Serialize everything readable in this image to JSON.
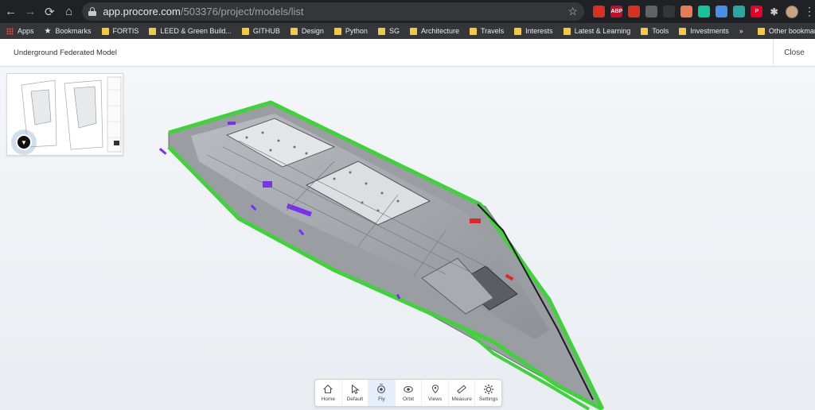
{
  "browser": {
    "url_host": "app.procore.com",
    "url_path": "/503376/project/models/list"
  },
  "bookmarks": [
    {
      "label": "Apps",
      "icon": "apps-grid-icon"
    },
    {
      "label": "Bookmarks",
      "icon": "star-icon"
    },
    {
      "label": "FORTIS",
      "icon": "folder-icon"
    },
    {
      "label": "LEED & Green Build...",
      "icon": "folder-icon"
    },
    {
      "label": "GITHUB",
      "icon": "folder-icon"
    },
    {
      "label": "Design",
      "icon": "folder-icon"
    },
    {
      "label": "Python",
      "icon": "folder-icon"
    },
    {
      "label": "SG",
      "icon": "folder-icon"
    },
    {
      "label": "Architecture",
      "icon": "folder-icon"
    },
    {
      "label": "Travels",
      "icon": "folder-icon"
    },
    {
      "label": "Interests",
      "icon": "folder-icon"
    },
    {
      "label": "Latest & Learning",
      "icon": "folder-icon"
    },
    {
      "label": "Tools",
      "icon": "folder-icon"
    },
    {
      "label": "Investments",
      "icon": "folder-icon"
    }
  ],
  "bookmarks_more": "»",
  "other_bookmarks": "Other bookmarks",
  "extensions": [
    {
      "name": "shield-ext-icon",
      "color": "#d93025",
      "text": ""
    },
    {
      "name": "adblock-plus-icon",
      "color": "#c70d2c",
      "text": "ABP"
    },
    {
      "name": "acrobat-icon",
      "color": "#d93025",
      "text": ""
    },
    {
      "name": "dark-ext-icon",
      "color": "#5f6368",
      "text": ""
    },
    {
      "name": "broadcast-icon",
      "color": "#35363a",
      "text": ""
    },
    {
      "name": "mail-ext-icon",
      "color": "#e67c52",
      "text": ""
    },
    {
      "name": "grammarly-icon",
      "color": "#15c39a",
      "text": ""
    },
    {
      "name": "dropbox-icon",
      "color": "#4a8fe7",
      "text": ""
    },
    {
      "name": "screenshot-ext-icon",
      "color": "#2aa5a0",
      "text": ""
    },
    {
      "name": "pinterest-icon",
      "color": "#e60023",
      "text": "P"
    }
  ],
  "header": {
    "model_title": "Underground Federated Model",
    "close_label": "Close"
  },
  "toolbar": [
    {
      "label": "Home",
      "icon": "home-icon",
      "active": false
    },
    {
      "label": "Default",
      "icon": "cursor-icon",
      "active": false
    },
    {
      "label": "Fly",
      "icon": "fly-icon",
      "active": true
    },
    {
      "label": "Orbit",
      "icon": "orbit-icon",
      "active": false
    },
    {
      "label": "Views",
      "icon": "views-pin-icon",
      "active": false
    },
    {
      "label": "Measure",
      "icon": "ruler-icon",
      "active": false
    },
    {
      "label": "Settings",
      "icon": "gear-icon",
      "active": false
    }
  ],
  "colors": {
    "pipe_green": "#3fd23a",
    "marker_purple": "#7b2ff0",
    "accent_red": "#e0262a",
    "active_tool_bg": "#e6eefa"
  }
}
